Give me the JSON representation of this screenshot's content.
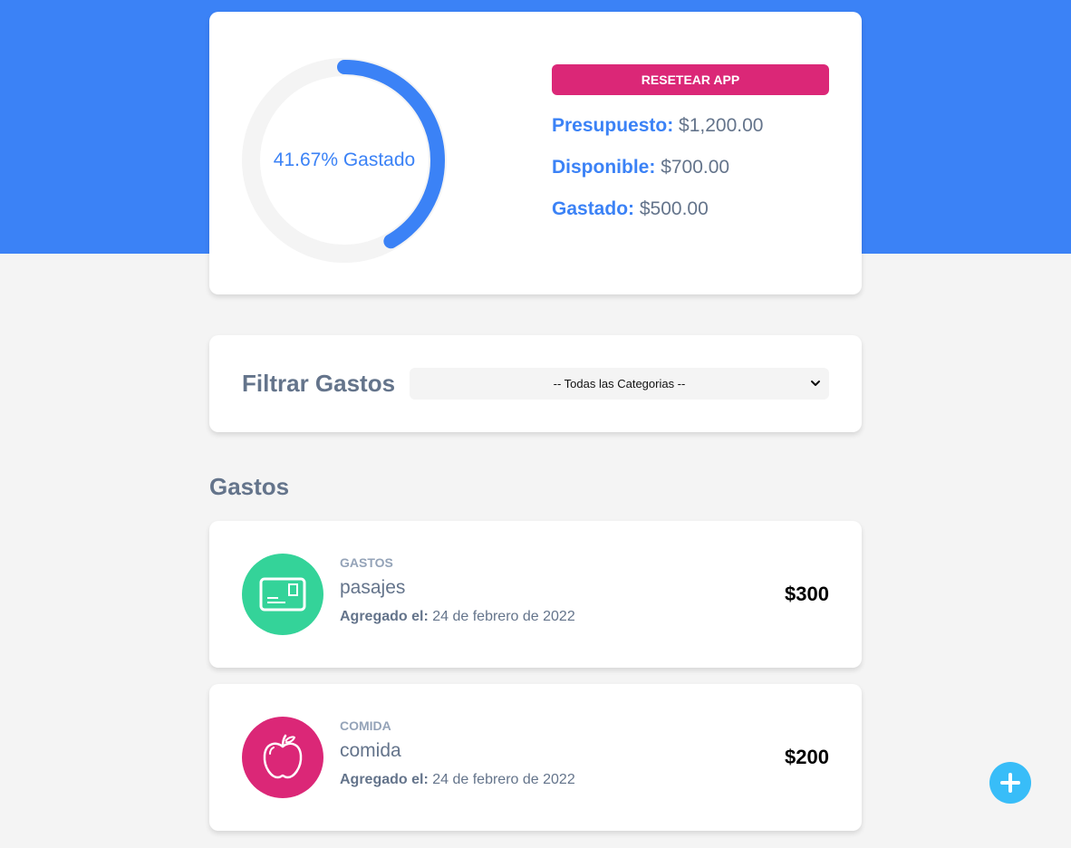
{
  "budget": {
    "percent_label": "41.67% Gastado",
    "percent_spent": 41.67,
    "reset_label": "RESETEAR APP",
    "presupuesto_label": "Presupuesto:",
    "presupuesto_value": "$1,200.00",
    "disponible_label": "Disponible:",
    "disponible_value": "$700.00",
    "gastado_label": "Gastado:",
    "gastado_value": "$500.00"
  },
  "filter": {
    "title": "Filtrar Gastos",
    "selected": "-- Todas las Categorias --"
  },
  "expenses": {
    "title": "Gastos",
    "items": [
      {
        "category": "GASTOS",
        "name": "pasajes",
        "date_label": "Agregado el:",
        "date": "24 de febrero de 2022",
        "amount": "$300",
        "icon": "ticket-icon",
        "color": "#34d399"
      },
      {
        "category": "COMIDA",
        "name": "comida",
        "date_label": "Agregado el:",
        "date": "24 de febrero de 2022",
        "amount": "$200",
        "icon": "apple-icon",
        "color": "#db2777"
      }
    ]
  },
  "colors": {
    "primary": "#3b82f6",
    "accent": "#db2777",
    "fab": "#38bdf8",
    "track": "#f4f4f4"
  }
}
